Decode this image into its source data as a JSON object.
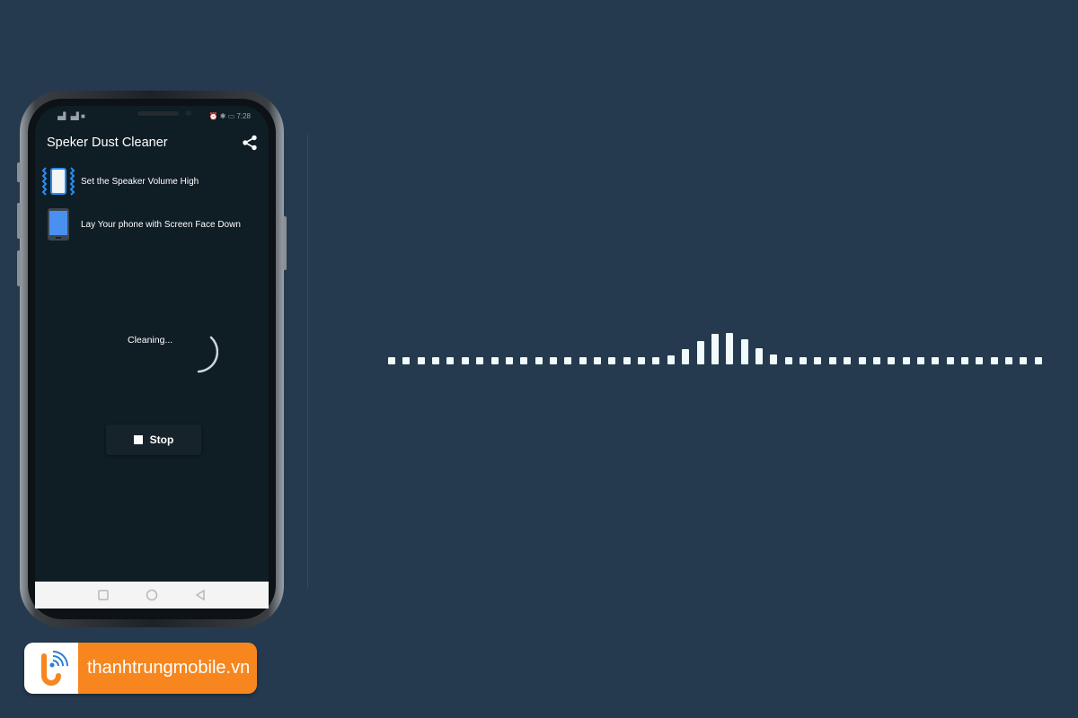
{
  "status_bar": {
    "time": "7:28"
  },
  "app": {
    "title": "Speker Dust Cleaner",
    "share_icon": "share-icon"
  },
  "steps": [
    {
      "icon": "vibrating-phone-icon",
      "label": "Set the Speaker Volume High"
    },
    {
      "icon": "phone-face-down-icon",
      "label": "Lay Your phone with Screen Face Down"
    }
  ],
  "progress": {
    "label": "Cleaning..."
  },
  "stop_button": {
    "label": "Stop",
    "icon": "stop-icon"
  },
  "navbar": {
    "icons": [
      "recent-apps-icon",
      "home-icon",
      "back-icon"
    ]
  },
  "visualizer": {
    "levels": [
      1,
      1,
      1,
      1,
      1,
      1,
      1,
      1,
      1,
      1,
      1,
      1,
      1,
      1,
      1,
      1,
      1,
      1,
      1,
      1.3,
      2.1,
      3.2,
      4.2,
      4.4,
      3.5,
      2.3,
      1.4,
      1,
      1,
      1,
      1,
      1,
      1,
      1,
      1,
      1,
      1,
      1,
      1,
      1,
      1,
      1,
      1,
      1,
      1
    ],
    "color": "#f2fbfb"
  },
  "brand": {
    "name": "thanhtrungmobile.vn",
    "color": "#f7861e"
  }
}
